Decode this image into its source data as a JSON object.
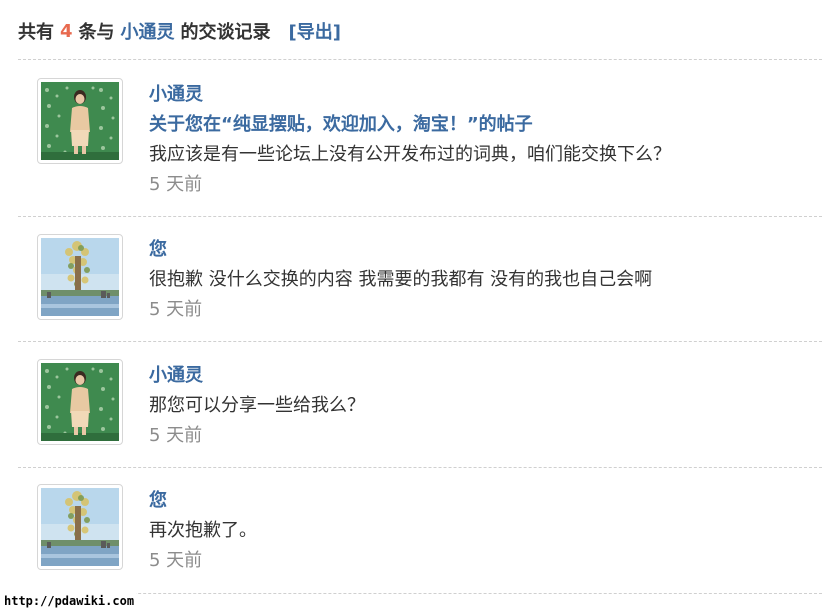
{
  "header": {
    "prefix": "共有",
    "count": "4",
    "middle": "条与",
    "peer_name": "小通灵",
    "suffix": "的交谈记录",
    "export_label": "[导出]"
  },
  "messages": [
    {
      "sender": "小通灵",
      "avatar": "woman-portrait-avatar",
      "subject": "关于您在“纯显摆贴，欢迎加入，淘宝！”的帖子",
      "body": "我应该是有一些论坛上没有公开发布过的词典，咱们能交换下么？",
      "time": "5 天前"
    },
    {
      "sender": "您",
      "avatar": "tree-tower-avatar",
      "body": "很抱歉 没什么交换的内容 我需要的我都有 没有的我也自己会啊",
      "time": "5 天前"
    },
    {
      "sender": "小通灵",
      "avatar": "woman-portrait-avatar",
      "body": "那您可以分享一些给我么？",
      "time": "5 天前"
    },
    {
      "sender": "您",
      "avatar": "tree-tower-avatar",
      "body": "再次抱歉了。",
      "time": "5 天前"
    }
  ],
  "watermark": "http://pdawiki.com",
  "colors": {
    "link": "#3b6aa0",
    "count": "#e86a4f",
    "text": "#333333",
    "muted": "#8c8c8c"
  }
}
